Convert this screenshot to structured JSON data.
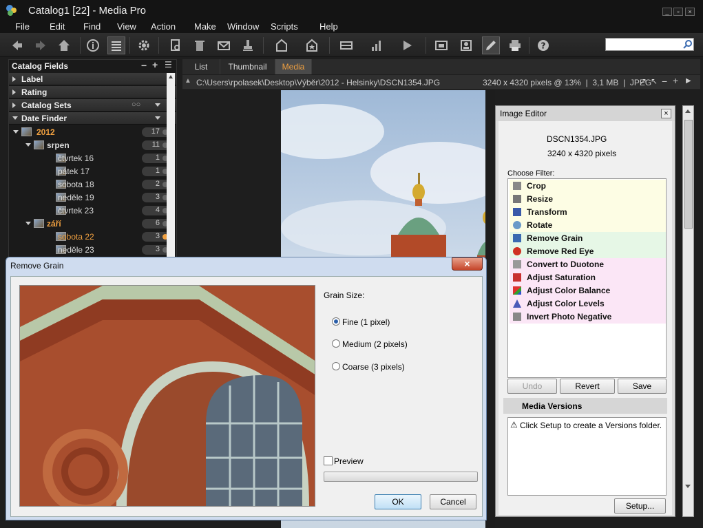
{
  "window": {
    "title": "Catalog1 [22] - Media Pro"
  },
  "menu": [
    "File",
    "Edit",
    "Find",
    "View",
    "Action",
    "Make",
    "Window",
    "Scripts",
    "Help"
  ],
  "toolbar": {
    "icons": [
      "back-arrow-icon",
      "forward-arrow-icon",
      "home-icon",
      "info-icon",
      "list-view-icon",
      "gear-icon",
      "search-document-icon",
      "trash-icon",
      "mail-icon",
      "stamp-icon",
      "catalog-home-icon",
      "star-badge-icon",
      "ribbon-icon",
      "bar-chart-icon",
      "play-icon",
      "slideshow-icon",
      "portrait-icon",
      "pencil-icon",
      "printer-icon",
      "help-icon"
    ],
    "search_placeholder": ""
  },
  "left_panel": {
    "title": "Catalog Fields",
    "sections": [
      "Label",
      "Rating",
      "Catalog Sets",
      "Date Finder"
    ],
    "tree": [
      {
        "label": "2012",
        "count": "17",
        "level": 0,
        "highlight": true
      },
      {
        "label": "srpen",
        "count": "11",
        "level": 1,
        "highlight": false
      },
      {
        "label": "čtvrtek 16",
        "count": "1",
        "level": 2,
        "highlight": false
      },
      {
        "label": "pátek 17",
        "count": "1",
        "level": 2,
        "highlight": false
      },
      {
        "label": "sobota 18",
        "count": "2",
        "level": 2,
        "highlight": false
      },
      {
        "label": "neděle 19",
        "count": "3",
        "level": 2,
        "highlight": false
      },
      {
        "label": "čtvrtek 23",
        "count": "4",
        "level": 2,
        "highlight": false
      },
      {
        "label": "září",
        "count": "6",
        "level": 1,
        "highlight": true
      },
      {
        "label": "sobota 22",
        "count": "3",
        "level": 2,
        "highlight": true
      },
      {
        "label": "neděle 23",
        "count": "3",
        "level": 2,
        "highlight": false
      }
    ]
  },
  "tabs": [
    {
      "label": "List",
      "active": false
    },
    {
      "label": "Thumbnail",
      "active": false
    },
    {
      "label": "Media",
      "active": true
    }
  ],
  "path_bar": {
    "path": "C:\\Users\\rpolasek\\Desktop\\Výběr\\2012 - Helsinky\\DSCN1354.JPG",
    "info": "3240 x 4320 pixels @ 13%  |  3,1 MB  |  JPEG"
  },
  "image_editor": {
    "title": "Image Editor",
    "filename": "DSCN1354.JPG",
    "dimensions": "3240 x 4320 pixels",
    "choose_filter_label": "Choose Filter:",
    "filters": [
      {
        "name": "Crop",
        "icon": "scissors-icon",
        "bg": "#fdfde4"
      },
      {
        "name": "Resize",
        "icon": "resize-icon",
        "bg": "#fdfde4"
      },
      {
        "name": "Transform",
        "icon": "transform-icon",
        "bg": "#fdfde4"
      },
      {
        "name": "Rotate",
        "icon": "rotate-icon",
        "bg": "#fdfde4"
      },
      {
        "name": "Remove Grain",
        "icon": "grain-icon",
        "bg": "#e6f7e6"
      },
      {
        "name": "Remove Red Eye",
        "icon": "red-eye-icon",
        "bg": "#e6f7e6"
      },
      {
        "name": "Convert to Duotone",
        "icon": "duotone-icon",
        "bg": "#fbe6f6"
      },
      {
        "name": "Adjust Saturation",
        "icon": "saturation-icon",
        "bg": "#fbe6f6"
      },
      {
        "name": "Adjust Color Balance",
        "icon": "color-balance-icon",
        "bg": "#fbe6f6"
      },
      {
        "name": "Adjust Color Levels",
        "icon": "color-levels-icon",
        "bg": "#fbe6f6"
      },
      {
        "name": "Invert Photo Negative",
        "icon": "invert-negative-icon",
        "bg": "#fbe6f6"
      }
    ],
    "buttons": {
      "undo": "Undo",
      "revert": "Revert",
      "save": "Save"
    },
    "versions_title": "Media Versions",
    "versions_msg": "Click Setup to create a Versions folder.",
    "setup": "Setup..."
  },
  "dialog": {
    "title": "Remove Grain",
    "grain_label": "Grain Size:",
    "options": [
      {
        "label": "Fine (1 pixel)",
        "selected": true
      },
      {
        "label": "Medium (2 pixels)",
        "selected": false
      },
      {
        "label": "Coarse (3 pixels)",
        "selected": false
      }
    ],
    "preview_label": "Preview",
    "preview_checked": false,
    "ok": "OK",
    "cancel": "Cancel"
  }
}
